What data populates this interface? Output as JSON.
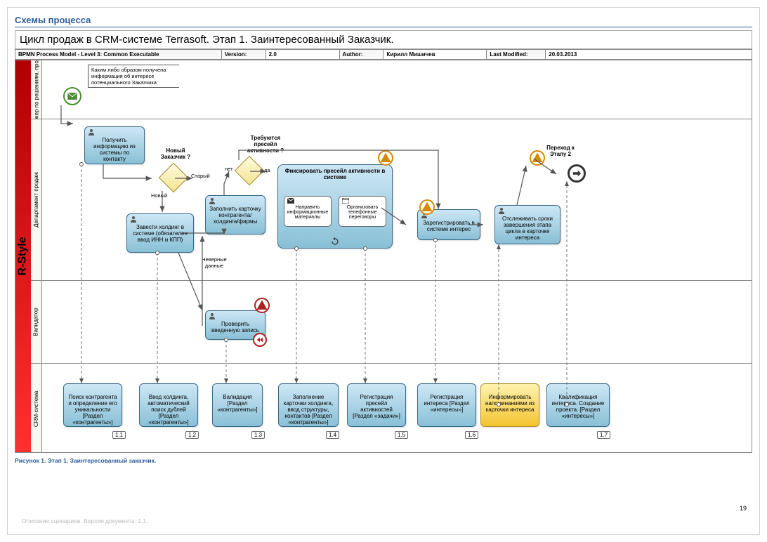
{
  "section_title": "Схемы процесса",
  "diagram_title": "Цикл продаж в CRM-системе Terrasoft. Этап 1. Заинтересованный Заказчик.",
  "meta": {
    "model_label": "BPMN Process Model - Level 3: Common Executable",
    "version_label": "Version:",
    "version": "2.0",
    "author_label": "Author:",
    "author": "Кирилл Мишичев",
    "modified_label": "Last Modified:",
    "modified": "20.03.2013"
  },
  "pool": "R-Style",
  "lanes": {
    "l1": "Менеджер по решениям, продуктам",
    "l2": "Департамент продаж",
    "l3": "Валидатор",
    "l4": "CRM-система"
  },
  "annotation1": "Каким либо образом получена информация об интересе потенциального Заказчика",
  "tasks": {
    "t1": "Получить информацию из системы по контакту",
    "t2": "Завести холдинг в системе (обязателен ввод ИНН и КПП)",
    "t3": "Заполнить карточку контрагента/ холдинга/фирмы",
    "t4": "Зарегистрировать в системе интерес",
    "t5": "Отслеживать сроки завершения этапа цикла в карточке интереса",
    "t6": "Проверить введенную запись",
    "sp_title": "Фиксировать пресейл активности в системе",
    "sp_a": "Направить информационные материалы",
    "sp_b": "Организовать телефонные переговоры",
    "crm1": "Поиск контрагента и определение его уникальности [Раздел «контрагенты»]",
    "crm2": "Ввод холдинга, автоматический поиск дублей [Раздел «контрагенты»]",
    "crm3": "Валидация [Раздел «контрагенты»]",
    "crm4": "Заполнение карточки холдинга, ввод структуры, контактов [Раздел «контрагенты»]",
    "crm5": "Регистрация пресейл активностей [Раздел «задачи»]",
    "crm6": "Регистрация интереса [Раздел «интересы»]",
    "crm7": "Информировать напоминаниями из карточки интереса",
    "crm8": "Квалификация интереса. Создание проекта. [Раздел «интересы»]"
  },
  "gateways": {
    "g1": "Новый Заказчик ?",
    "g1_yes": "Новый",
    "g1_no": "Старый",
    "g2": "Требуются пресейл активности ?",
    "g2_yes": "да",
    "g2_no": "нет",
    "wrong_data": "Неверные данные"
  },
  "transition": "Переход к Этапу 2",
  "refs": {
    "r1": "1.1",
    "r2": "1.2",
    "r3": "1.3",
    "r4": "1.4",
    "r5": "1.5",
    "r6": "1.6",
    "r7": "1.7"
  },
  "caption": "Рисунок 1. Этап 1. Заинтересованный заказчик.",
  "page_number": "19",
  "footer": "Описание сценариев. Версия документа: 1.1."
}
